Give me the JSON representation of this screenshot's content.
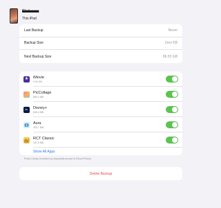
{
  "device": {
    "name": "Elaborer",
    "subtitle": "This iPad"
  },
  "backup_info": [
    {
      "label": "Last Backup",
      "value": "Never"
    },
    {
      "label": "Backup Size",
      "value": "Zero KB"
    },
    {
      "label": "Next Backup Size",
      "value": "86.55 GB"
    }
  ],
  "apps": [
    {
      "name": "iMovie",
      "size": "4.04 GB",
      "icon": "star-icon",
      "glyph": "★",
      "enabled": true
    },
    {
      "name": "PicCollage",
      "size": "880.4 MB",
      "icon": "collage-icon",
      "glyph": "",
      "enabled": true
    },
    {
      "name": "Disney+",
      "size": "636.4 MB",
      "icon": "disney-plus-icon",
      "glyph": "D+",
      "enabled": true
    },
    {
      "name": "Aura",
      "size": "393.7 MB",
      "icon": "aura-icon",
      "glyph": "",
      "enabled": true
    },
    {
      "name": "RCT Classic",
      "size": "187.8 MB",
      "icon": "rct-icon",
      "glyph": "",
      "enabled": true
    }
  ],
  "show_all_apps_label": "Show All Apps",
  "footnote": "Photo Library is backed up separately as part of iCloud Photos.",
  "delete_backup_label": "Delete Backup",
  "colors": {
    "background": "#f2f2f7",
    "toggle_on": "#5ac44f",
    "link": "#2f7bef",
    "destructive": "#f04545"
  }
}
